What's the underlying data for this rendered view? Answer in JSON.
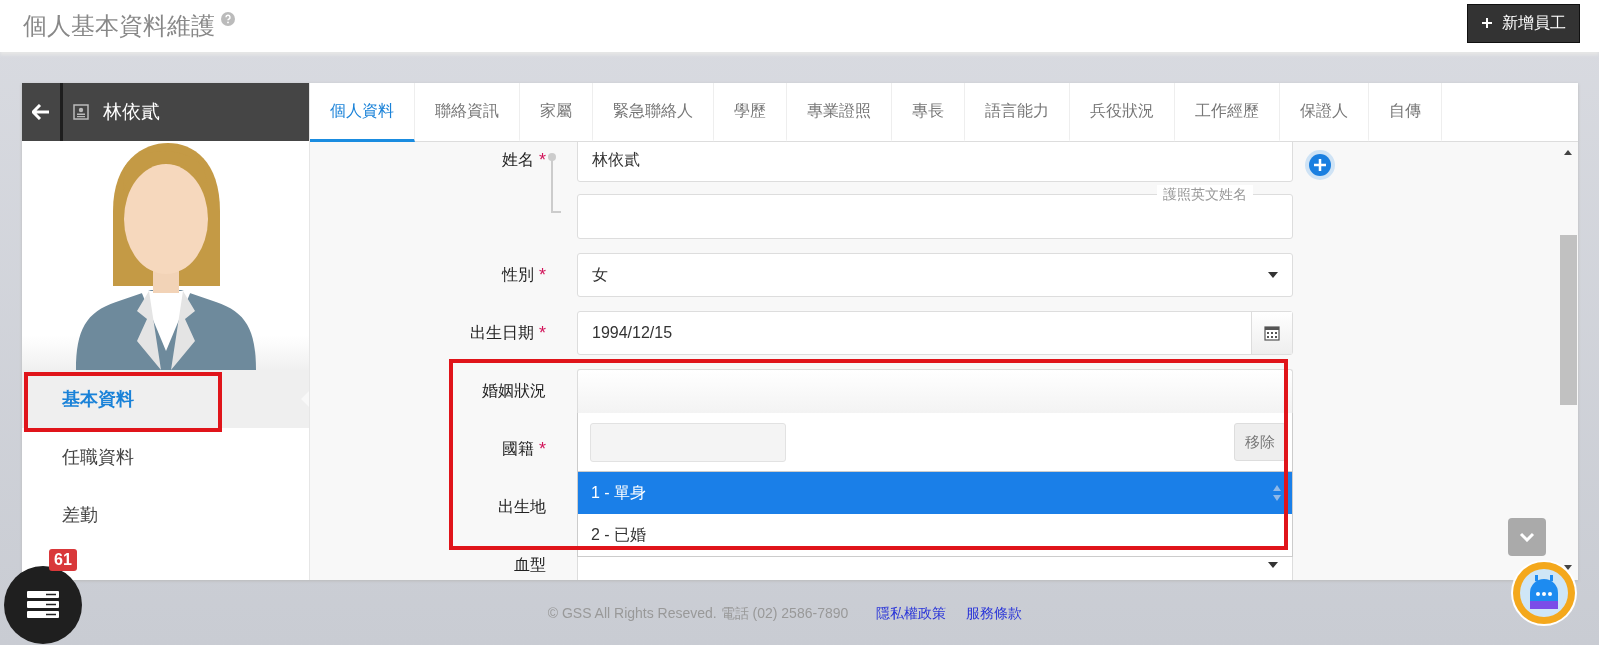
{
  "header": {
    "title": "個人基本資料維護",
    "add_button": "新增員工"
  },
  "employee": {
    "name": "林依貳"
  },
  "side_nav": [
    {
      "label": "基本資料",
      "selected": true
    },
    {
      "label": "任職資料",
      "selected": false
    },
    {
      "label": "差勤",
      "selected": false
    }
  ],
  "tabs": [
    {
      "label": "個人資料",
      "selected": true
    },
    {
      "label": "聯絡資訊",
      "selected": false
    },
    {
      "label": "家屬",
      "selected": false
    },
    {
      "label": "緊急聯絡人",
      "selected": false
    },
    {
      "label": "學歷",
      "selected": false
    },
    {
      "label": "專業證照",
      "selected": false
    },
    {
      "label": "專長",
      "selected": false
    },
    {
      "label": "語言能力",
      "selected": false
    },
    {
      "label": "兵役狀況",
      "selected": false
    },
    {
      "label": "工作經歷",
      "selected": false
    },
    {
      "label": "保證人",
      "selected": false
    },
    {
      "label": "自傳",
      "selected": false
    }
  ],
  "form": {
    "required_mark": "*",
    "fields": [
      {
        "kind": "name",
        "label": "姓名",
        "required": true,
        "value": "林依貳",
        "sub_legend": "護照英文姓名"
      },
      {
        "kind": "select",
        "label": "性別",
        "required": true,
        "value": "女"
      },
      {
        "kind": "date",
        "label": "出生日期",
        "required": true,
        "value": "1994/12/15"
      },
      {
        "kind": "open-select",
        "label": "婚姻狀況",
        "required": false,
        "remove_button": "移除",
        "options": [
          {
            "label": "1 - 單身",
            "selected": true
          },
          {
            "label": "2 - 已婚",
            "selected": false
          }
        ]
      },
      {
        "kind": "text",
        "label": "國籍",
        "required": true
      },
      {
        "kind": "text",
        "label": "出生地",
        "required": false
      },
      {
        "kind": "select",
        "label": "血型",
        "required": false
      }
    ]
  },
  "menu_badge": "61",
  "footer": {
    "copyright": "© GSS All Rights Reseved. 電話 (02) 2586-7890",
    "links": [
      "隱私權政策",
      "服務條款"
    ]
  }
}
